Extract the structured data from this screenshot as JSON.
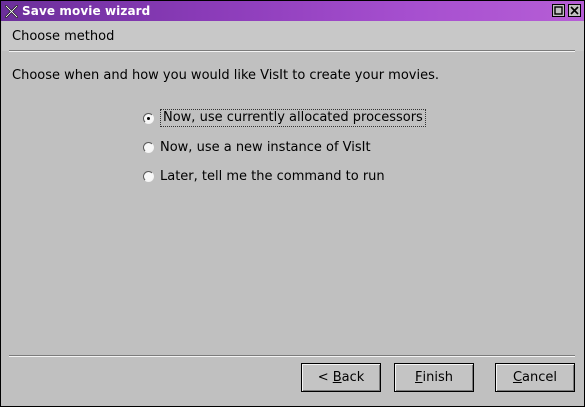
{
  "window": {
    "title": "Save movie wizard",
    "icons": {
      "app": "x-logo-icon",
      "maximize": "maximize-icon",
      "close": "close-icon"
    },
    "titlebar_colors": [
      "#6b2f9a",
      "#b65ed6"
    ]
  },
  "page": {
    "heading": "Choose method",
    "instruction": "Choose when and how you would like VisIt to create your movies."
  },
  "options": [
    {
      "label": "Now, use currently allocated processors",
      "selected": true
    },
    {
      "label": "Now, use a new instance of VisIt",
      "selected": false
    },
    {
      "label": "Later, tell me the command to run",
      "selected": false
    }
  ],
  "buttons": {
    "back": {
      "prefix": "< ",
      "mnemonic": "B",
      "rest": "ack"
    },
    "finish": {
      "prefix": "",
      "mnemonic": "F",
      "rest": "inish"
    },
    "cancel": {
      "prefix": "",
      "mnemonic": "C",
      "rest": "ancel"
    }
  }
}
